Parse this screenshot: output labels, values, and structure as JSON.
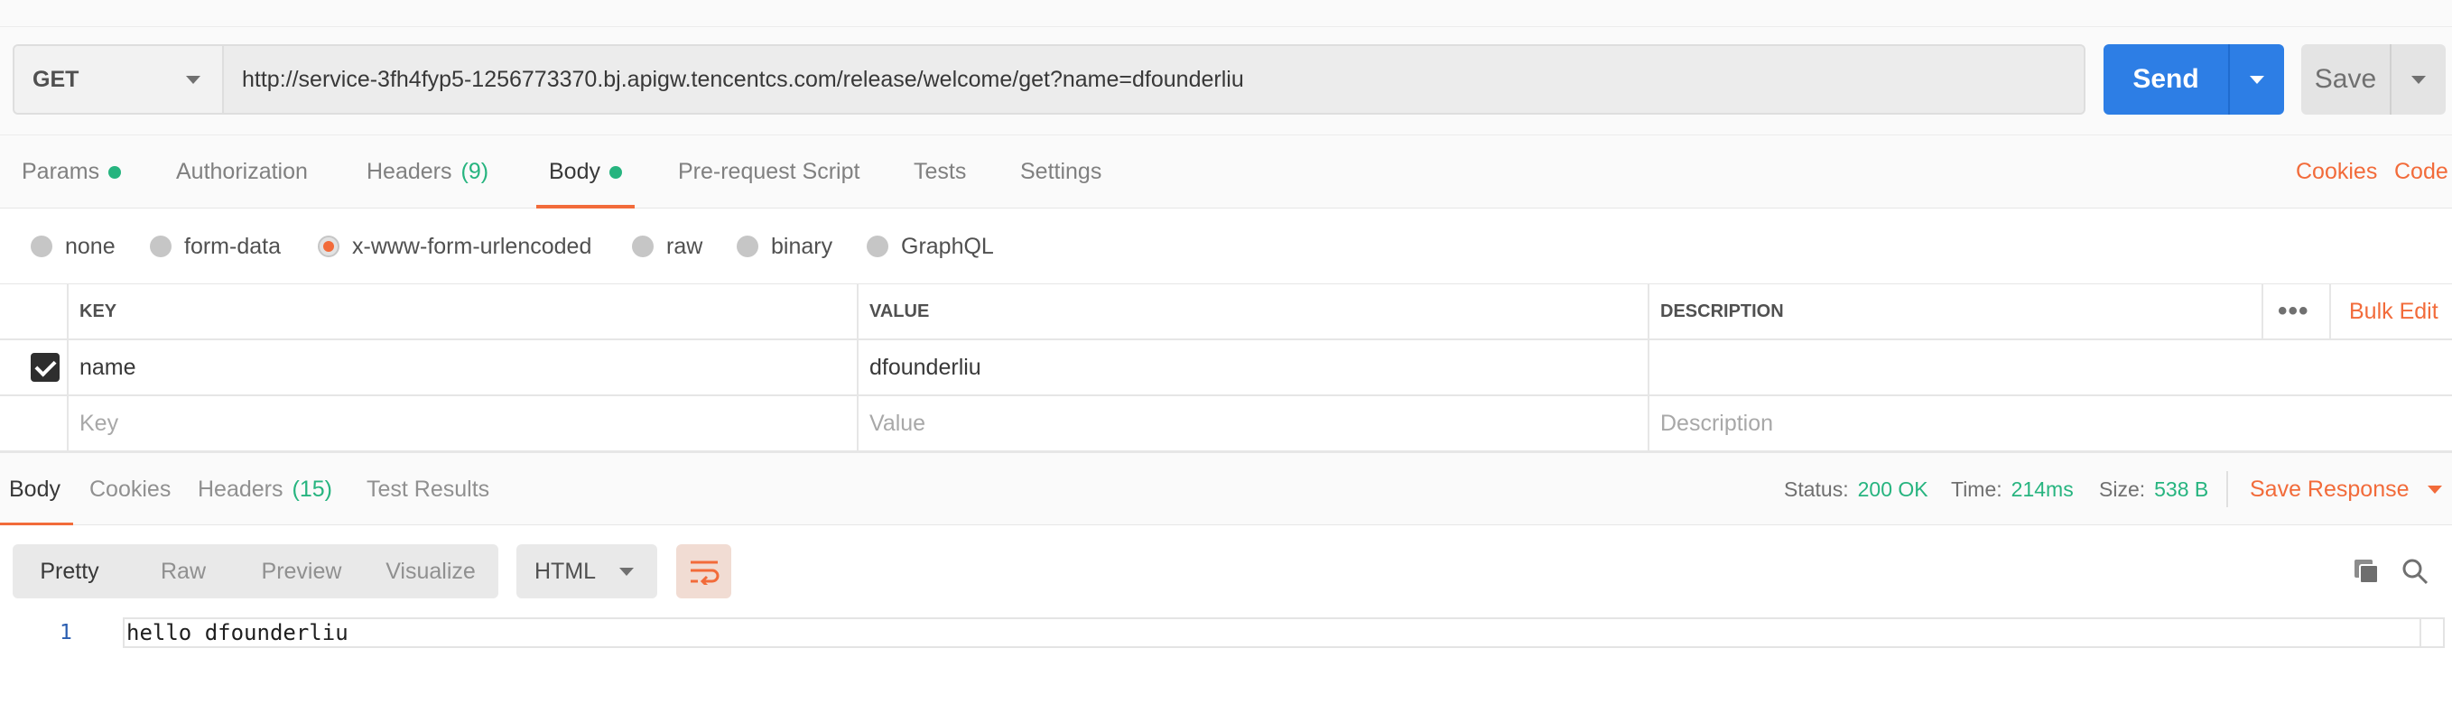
{
  "request": {
    "method": "GET",
    "url": "http://service-3fh4fyp5-1256773370.bj.apigw.tencentcs.com/release/welcome/get?name=dfounderliu",
    "send_label": "Send",
    "save_label": "Save"
  },
  "request_tabs": {
    "params": "Params",
    "authorization": "Authorization",
    "headers": "Headers",
    "headers_count": "(9)",
    "body": "Body",
    "pre_request": "Pre-request Script",
    "tests": "Tests",
    "settings": "Settings",
    "cookies": "Cookies",
    "code": "Code"
  },
  "body_types": {
    "none": "none",
    "form_data": "form-data",
    "urlencoded": "x-www-form-urlencoded",
    "raw": "raw",
    "binary": "binary",
    "graphql": "GraphQL",
    "selected": "x-www-form-urlencoded"
  },
  "params_table": {
    "headers": {
      "key": "KEY",
      "value": "VALUE",
      "description": "DESCRIPTION",
      "bulk_edit": "Bulk Edit",
      "more": "•••"
    },
    "rows": [
      {
        "checked": true,
        "key": "name",
        "value": "dfounderliu",
        "description": ""
      }
    ],
    "placeholders": {
      "key": "Key",
      "value": "Value",
      "description": "Description"
    }
  },
  "response_tabs": {
    "body": "Body",
    "cookies": "Cookies",
    "headers": "Headers",
    "headers_count": "(15)",
    "test_results": "Test Results"
  },
  "response_meta": {
    "status_label": "Status:",
    "status_value": "200 OK",
    "time_label": "Time:",
    "time_value": "214ms",
    "size_label": "Size:",
    "size_value": "538 B",
    "save_response": "Save Response"
  },
  "response_view": {
    "modes": [
      "Pretty",
      "Raw",
      "Preview",
      "Visualize"
    ],
    "active_mode": "Pretty",
    "format": "HTML"
  },
  "response_body": {
    "lines": [
      {
        "number": "1",
        "text": "hello dfounderliu"
      }
    ]
  },
  "colors": {
    "accent_orange": "#f26b3a",
    "send_blue": "#2d7ee5",
    "status_green": "#26b47f"
  },
  "icons": [
    "chevron-down-icon",
    "wrap-lines-icon",
    "copy-icon",
    "search-icon",
    "check-icon"
  ]
}
